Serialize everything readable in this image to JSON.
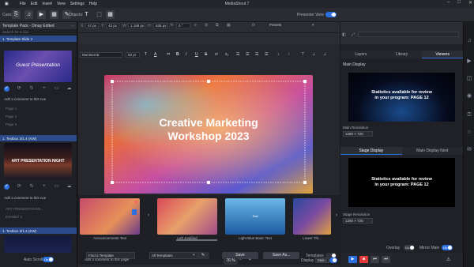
{
  "app": {
    "title": "MediaShout 7"
  },
  "menu": [
    "File",
    "Edit",
    "Insert",
    "View",
    "Settings",
    "Help"
  ],
  "toolbar": {
    "cues_label": "Cues:",
    "objects_label": "Objects:",
    "presenter_view_label": "Presenter View",
    "presenter_view_state": "Off"
  },
  "left": {
    "pack_title": "Template Pack - Dinay Edited",
    "search_placeholder": "Search for a cue",
    "cue1_label": "1. Template Slide 2",
    "cue1_title": "Guest Presentation",
    "comment_placeholder": "Add a comment to this cue",
    "pages1": [
      "Page 1",
      "Page 2",
      "Page 3"
    ],
    "cue2_label": "1. Textbox 3/1.4 (KW)",
    "cue2_title": "ART PRESENTATION NIGHT",
    "comment2": "Add a comment to this cue",
    "pages2": [
      "ART PRESENTATION...",
      "EXHIBIT 1"
    ],
    "cue3_label": "1. Textbox 3/1.4 (KW)",
    "auto_scroll_label": "Auto Scroll",
    "auto_scroll_state": "On"
  },
  "format": {
    "x": "47 px",
    "y": "43 px",
    "w": "1 188 px",
    "h": "635 px",
    "angle": "0 °",
    "presets_label": "Presets",
    "font": "Montserrat",
    "size": "52 pt"
  },
  "slide": {
    "title_line1": "Creative Marketing",
    "title_line2": "Workshop 2023"
  },
  "templates": {
    "cards": [
      {
        "label": "Announcements Text"
      },
      {
        "label": "Left Justified"
      },
      {
        "label": "Light Blue Basic Text",
        "inner": "Test"
      },
      {
        "label": "Lower Thi..."
      }
    ],
    "find_placeholder": "Find a Template",
    "filter": "All Templates",
    "save_label": "Save",
    "save_as_label": "Save As...",
    "templates_label": "Templates"
  },
  "status": {
    "comment_placeholder": "Add a comment to this page",
    "zoom": "76 %",
    "display_label": "Display",
    "display_value": "Main"
  },
  "right": {
    "tabs": [
      "Layers",
      "Library",
      "Viewers"
    ],
    "main_display_label": "Main Display",
    "message_line1": "Statistics available for review",
    "message_line2": "in your program: PAGE 12",
    "main_resolution_label": "Main Resolution",
    "main_resolution": "1280 × 720",
    "display_tabs": [
      "Stage Display",
      "Main Display Next"
    ],
    "stage_resolution_label": "Stage Resolution",
    "stage_resolution": "1280 × 720",
    "overlay_label": "Overlay",
    "overlay_state": "No",
    "mirror_label": "Mirror Main",
    "mirror_state": "On"
  }
}
